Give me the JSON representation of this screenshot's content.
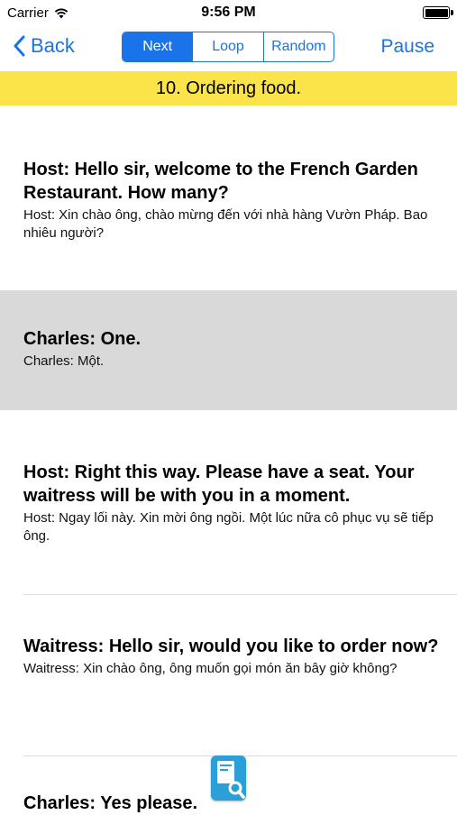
{
  "status": {
    "carrier": "Carrier",
    "time": "9:56 PM"
  },
  "nav": {
    "back_label": "Back",
    "pause_label": "Pause",
    "segments": [
      {
        "label": "Next"
      },
      {
        "label": "Loop"
      },
      {
        "label": "Random"
      }
    ]
  },
  "lesson": {
    "title": "10. Ordering food."
  },
  "lines": [
    {
      "en": "Host: Hello sir, welcome to the French Garden Restaurant. How many?",
      "vi": "Host: Xin chào ông, chào mừng đến với nhà hàng Vườn Pháp. Bao nhiêu người?"
    },
    {
      "en": "Charles: One.",
      "vi": "Charles: Một."
    },
    {
      "en": "Host: Right this way. Please have a seat. Your waitress will be with you in a moment.",
      "vi": "Host: Ngay lối này. Xin mời ông ngồi. Một lúc nữa cô phục vụ sẽ tiếp ông."
    },
    {
      "en": "Waitress: Hello sir, would you like to order now?",
      "vi": "Waitress: Xin chào ông, ông muốn gọi món ăn bây giờ không?"
    },
    {
      "en": "Charles: Yes please.",
      "vi": ""
    }
  ],
  "icons": {
    "back": "chevron-left-icon",
    "wifi": "wifi-icon",
    "battery": "battery-icon",
    "dictionary": "dictionary-search-icon"
  },
  "colors": {
    "accent": "#1a73e8",
    "title_bar": "#fbe44a",
    "selected_row": "#d9d9d9"
  }
}
